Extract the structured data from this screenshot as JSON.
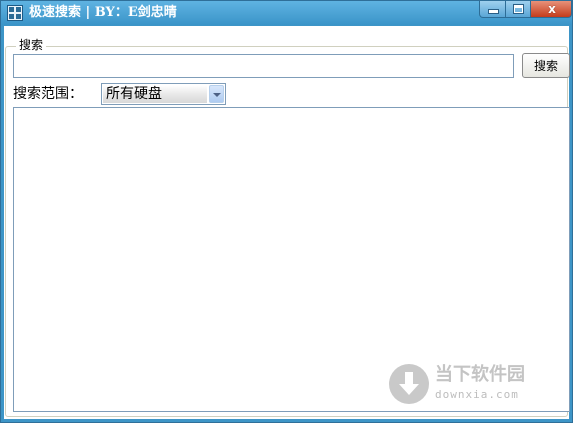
{
  "window": {
    "title": "极速搜索 | BY：E剑忠晴",
    "accent_color": "#3d95c7",
    "controls": {
      "minimize_icon": "minimize-icon",
      "maximize_icon": "maximize-icon",
      "close_label": "x"
    }
  },
  "search_group": {
    "label": "搜索",
    "input_value": "",
    "input_placeholder": "",
    "button_label": "搜索"
  },
  "scope": {
    "label": "搜索范围：",
    "selected": "所有硬盘"
  },
  "results": {
    "rows": []
  },
  "watermark": {
    "brand": "当下软件园",
    "url": "downxia.com"
  }
}
